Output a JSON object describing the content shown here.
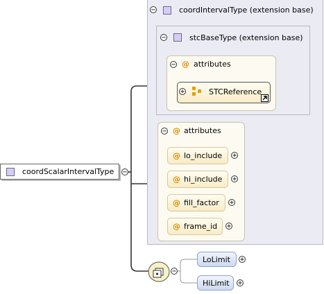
{
  "root": {
    "label": "coordScalarIntervalType",
    "icon": "complex-type-icon"
  },
  "coordIntervalType": {
    "label": "coordIntervalType (extension base)"
  },
  "stcBaseType": {
    "label": "stcBaseType (extension base)",
    "attributes_label": "attributes",
    "group_ref": "STCReference"
  },
  "attributes": {
    "label": "attributes",
    "items": [
      {
        "name": "lo_include"
      },
      {
        "name": "hi_include"
      },
      {
        "name": "fill_factor"
      },
      {
        "name": "frame_id"
      }
    ]
  },
  "sequence": {
    "elements": [
      {
        "name": "LoLimit"
      },
      {
        "name": "HiLimit"
      }
    ]
  },
  "glyphs": {
    "at": "@",
    "expand": "+",
    "collapse": "−"
  },
  "colors": {
    "attribute_at": "#d98a00",
    "type_icon": "#d6cdf3",
    "panel_grey": "#ebebf3",
    "element_box": "#cdd9f0"
  }
}
